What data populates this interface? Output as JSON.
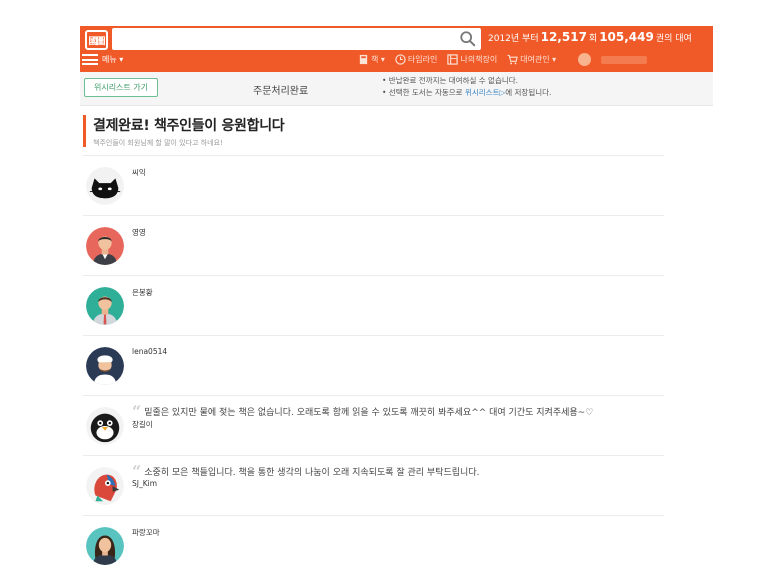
{
  "header": {
    "logo_text": "國圖",
    "search_placeholder": "",
    "stats": {
      "prefix": "2012년 부터",
      "members": "12,517",
      "members_unit": "회",
      "books": "105,449",
      "books_unit": "권의 대여"
    },
    "menu_label": "메뉴 ▾",
    "nav": [
      {
        "icon": "book-icon",
        "label": "책 ▾"
      },
      {
        "icon": "clock-icon",
        "label": "타임라인"
      },
      {
        "icon": "bookshelf-icon",
        "label": "나의책장이"
      },
      {
        "icon": "cart-icon",
        "label": "대여관인 ▾"
      }
    ]
  },
  "subbar": {
    "wishlist_button": "위시리스트 가기",
    "order_status": "주문처리완료",
    "notice_1": "• 반납완료 전까지는 대여하실 수 없습니다.",
    "notice_2_prefix": "• 선택한 도서는 자동으로 ",
    "notice_2_link": "위시리스트▷",
    "notice_2_suffix": "에 저장됩니다."
  },
  "title": {
    "main": "결제완료! 책주인들이 응원합니다",
    "sub": "책주인들이 회원님께 할 말이 있다고 하네요!"
  },
  "supporters": [
    {
      "name": "씨익",
      "comment": "",
      "avatar": "cat"
    },
    {
      "name": "영영",
      "comment": "",
      "avatar": "man-red"
    },
    {
      "name": "은봉황",
      "comment": "",
      "avatar": "man-teal"
    },
    {
      "name": "lena0514",
      "comment": "",
      "avatar": "chef"
    },
    {
      "name": "장길이",
      "comment": "밑줄은 있지만 물에 젖는 책은 없습니다. 오래도록 함께 읽을 수 있도록 깨끗히 봐주세요^^ 대여 기간도 지켜주세용~♡",
      "avatar": "bird"
    },
    {
      "name": "SJ_Kim",
      "comment": "소중히 모은 책들입니다. 책을 통한 생각의 나눔이 오래 지속되도록 잘 관리 부탁드립니다.",
      "avatar": "parrot"
    },
    {
      "name": "파랑꼬마",
      "comment": "",
      "avatar": "woman"
    }
  ],
  "colors": {
    "brand": "#f05a28",
    "wishlist_green": "#3f9d6a",
    "link_blue": "#3a86c8"
  }
}
